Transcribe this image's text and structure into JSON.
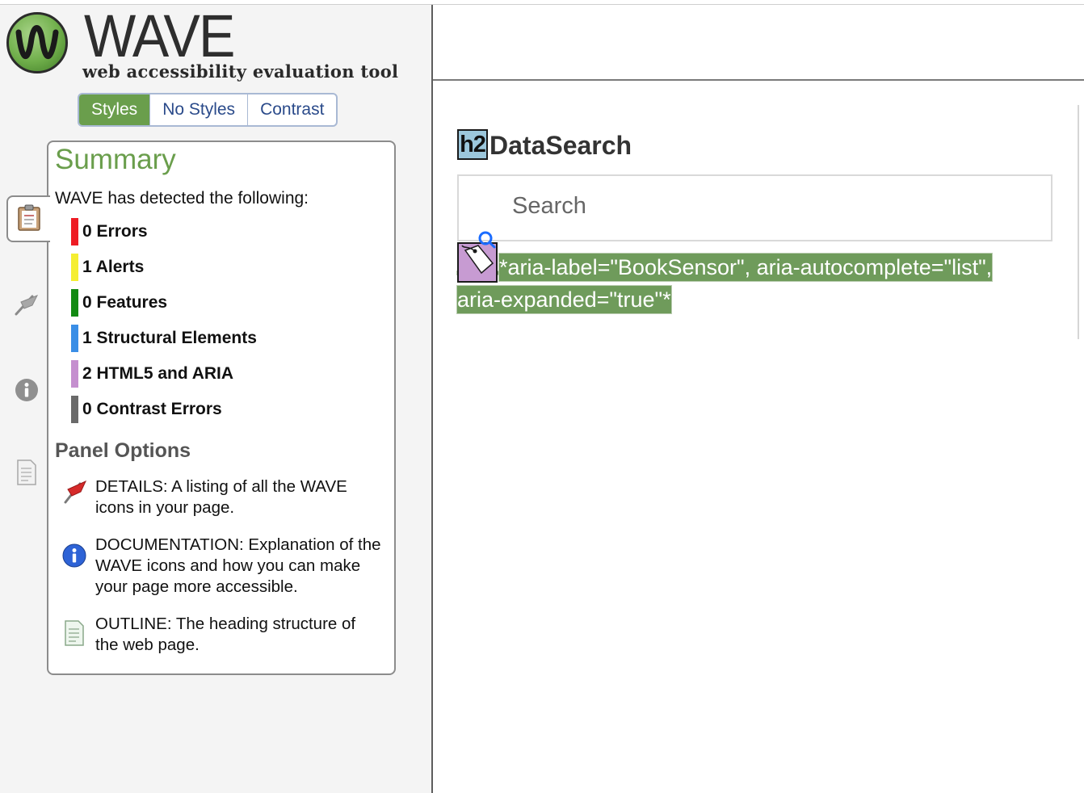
{
  "logo": {
    "title": "WAVE",
    "subtitle": "web accessibility evaluation tool"
  },
  "style_tabs": [
    {
      "label": "Styles",
      "active": true
    },
    {
      "label": "No Styles",
      "active": false
    },
    {
      "label": "Contrast",
      "active": false
    }
  ],
  "side_tabs": [
    {
      "icon": "clipboard-icon",
      "active": true
    },
    {
      "icon": "flag-icon",
      "active": false
    },
    {
      "icon": "info-icon",
      "active": false
    },
    {
      "icon": "outline-document-icon",
      "active": false
    }
  ],
  "summary": {
    "title": "Summary",
    "detected_text": "WAVE has detected the following:",
    "items": [
      {
        "label": "0 Errors",
        "color": "#ee1c24"
      },
      {
        "label": "1 Alerts",
        "color": "#f5ee31"
      },
      {
        "label": "0 Features",
        "color": "#128a12"
      },
      {
        "label": "1 Structural Elements",
        "color": "#3a8ee6"
      },
      {
        "label": "2 HTML5 and ARIA",
        "color": "#c58fcf"
      },
      {
        "label": "0 Contrast Errors",
        "color": "#6a6a6a"
      }
    ]
  },
  "panel_options": {
    "title": "Panel Options",
    "options": [
      {
        "icon": "flag-icon",
        "text": "DETAILS: A listing of all the WAVE icons in your page."
      },
      {
        "icon": "info-icon",
        "text": "DOCUMENTATION: Explanation of the WAVE icons and how you can make your page more accessible."
      },
      {
        "icon": "outline-document-icon",
        "text": "OUTLINE: The heading structure of the web page."
      }
    ]
  },
  "preview": {
    "h2_badge": "h2",
    "heading": "DataSearch",
    "search_placeholder": "Search",
    "aria_line1": "*aria-label=\"BookSensor\", aria-autocomplete=\"list\",",
    "aria_line2": "aria-expanded=\"true\"*"
  }
}
